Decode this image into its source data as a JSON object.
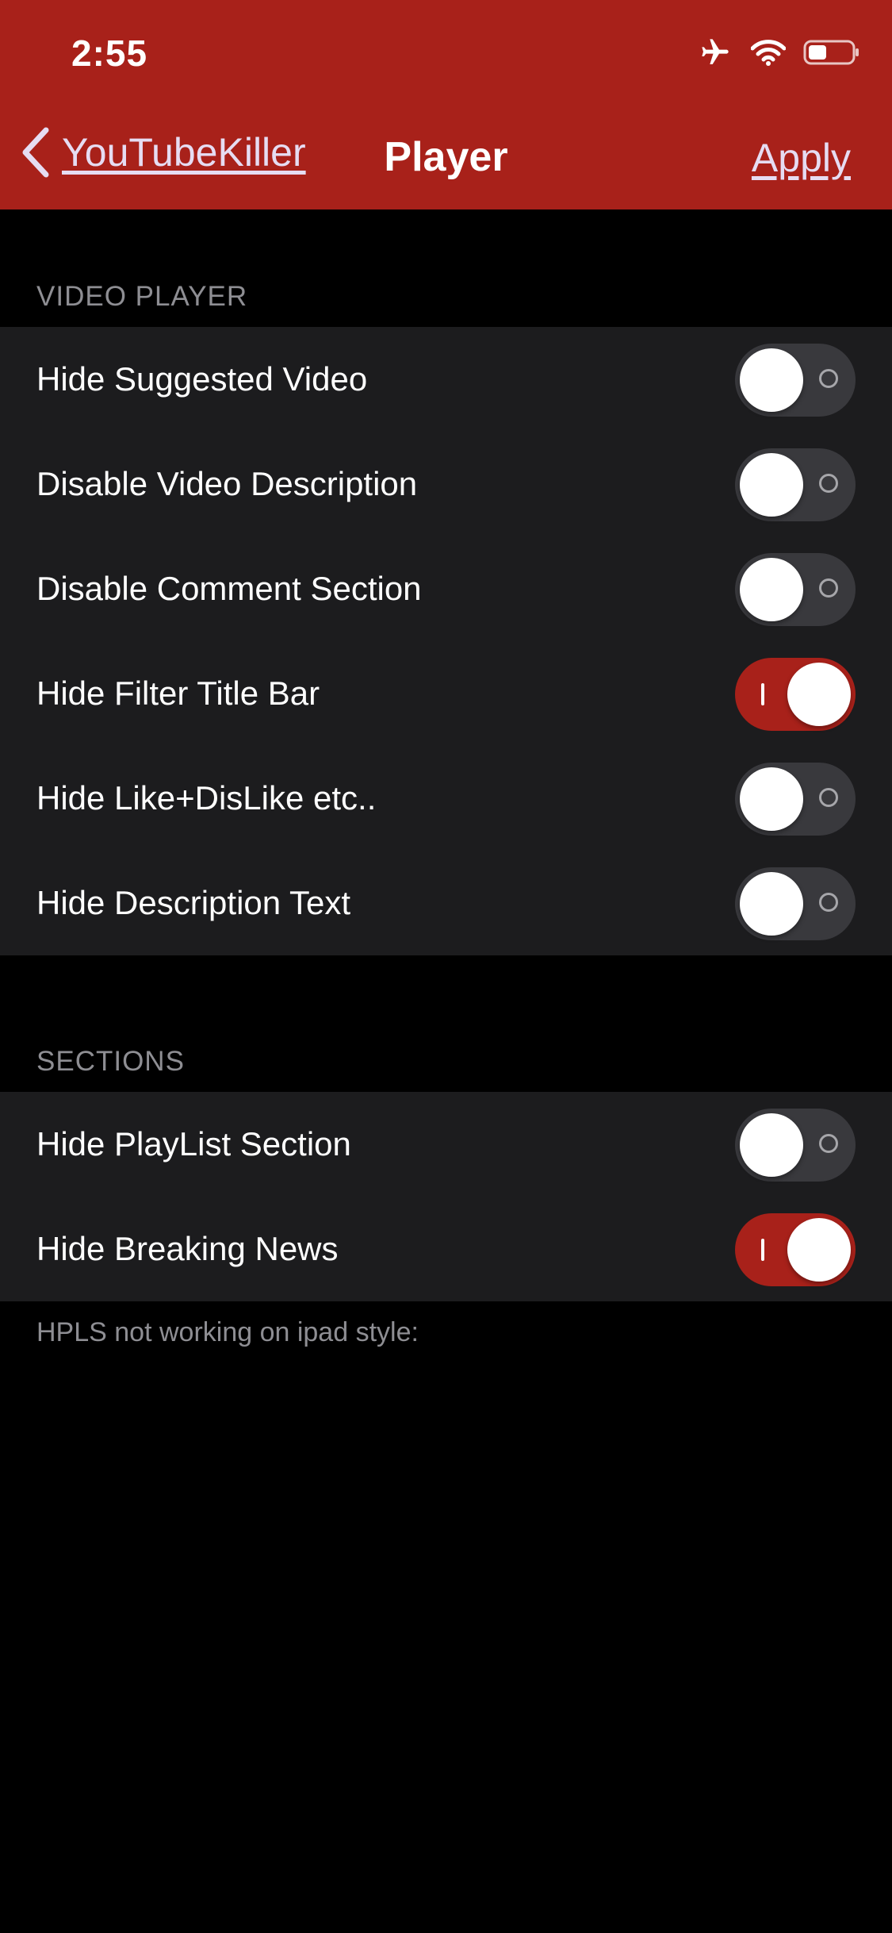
{
  "status_bar": {
    "time": "2:55",
    "icons": [
      "airplane-icon",
      "wifi-icon",
      "battery-icon"
    ]
  },
  "nav": {
    "back_label": "YouTubeKiller",
    "title": "Player",
    "apply_label": "Apply"
  },
  "colors": {
    "accent": "#a8211a",
    "background": "#000000",
    "group_background": "#1c1c1e",
    "toggle_off": "#39393d",
    "secondary_text": "#8e8e93",
    "link_text": "#e6dcf2"
  },
  "sections": [
    {
      "header": "VIDEO PLAYER",
      "rows": [
        {
          "label": "Hide Suggested Video",
          "on": false
        },
        {
          "label": "Disable Video Description",
          "on": false
        },
        {
          "label": "Disable Comment Section",
          "on": false
        },
        {
          "label": "Hide Filter Title Bar",
          "on": true
        },
        {
          "label": "Hide Like+DisLike etc..",
          "on": false
        },
        {
          "label": "Hide Description Text",
          "on": false
        }
      ]
    },
    {
      "header": "SECTIONS",
      "rows": [
        {
          "label": "Hide PlayList Section",
          "on": false
        },
        {
          "label": "Hide Breaking News",
          "on": true
        }
      ],
      "footer": "HPLS not working on ipad style:"
    }
  ]
}
